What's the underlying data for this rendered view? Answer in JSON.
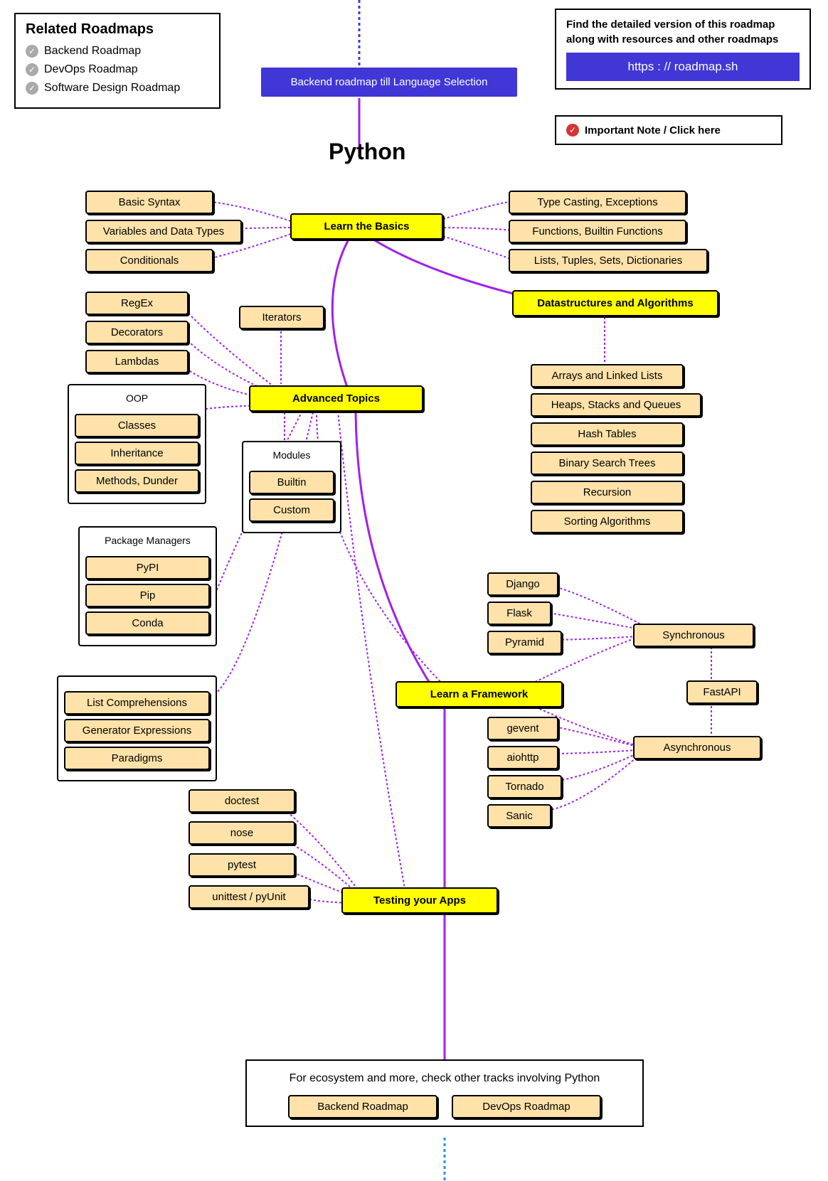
{
  "title": "Python",
  "related": {
    "heading": "Related Roadmaps",
    "items": [
      "Backend Roadmap",
      "DevOps Roadmap",
      "Software Design Roadmap"
    ]
  },
  "topBanner": {
    "text": "Find the detailed version of this roadmap along with resources and other roadmaps",
    "link": "https : // roadmap.sh"
  },
  "importantNote": "Important Note / Click here",
  "startNode": "Backend roadmap till Language Selection",
  "basics": {
    "main": "Learn the Basics",
    "left": [
      "Basic Syntax",
      "Variables and Data Types",
      "Conditionals"
    ],
    "right": [
      "Type Casting, Exceptions",
      "Functions, Builtin Functions",
      "Lists, Tuples, Sets, Dictionaries"
    ]
  },
  "dsa": {
    "main": "Datastructures and Algorithms",
    "items": [
      "Arrays and Linked Lists",
      "Heaps, Stacks and Queues",
      "Hash Tables",
      "Binary Search Trees",
      "Recursion",
      "Sorting Algorithms"
    ]
  },
  "advanced": {
    "main": "Advanced Topics",
    "iterators": "Iterators",
    "col1": [
      "RegEx",
      "Decorators",
      "Lambdas"
    ],
    "oop": {
      "title": "OOP",
      "items": [
        "Classes",
        "Inheritance",
        "Methods, Dunder"
      ]
    },
    "modules": {
      "title": "Modules",
      "items": [
        "Builtin",
        "Custom"
      ]
    },
    "pkg": {
      "title": "Package Managers",
      "items": [
        "PyPI",
        "Pip",
        "Conda"
      ]
    },
    "extras": [
      "List Comprehensions",
      "Generator Expressions",
      "Paradigms"
    ]
  },
  "framework": {
    "main": "Learn a Framework",
    "sync": {
      "label": "Synchronous",
      "items": [
        "Django",
        "Flask",
        "Pyramid"
      ]
    },
    "async": {
      "label": "Asynchronous",
      "extra": "FastAPI",
      "items": [
        "gevent",
        "aiohttp",
        "Tornado",
        "Sanic"
      ]
    }
  },
  "testing": {
    "main": "Testing your Apps",
    "items": [
      "doctest",
      "nose",
      "pytest",
      "unittest / pyUnit"
    ]
  },
  "footer": {
    "text": "For ecosystem and more, check other tracks involving Python",
    "links": [
      "Backend Roadmap",
      "DevOps Roadmap"
    ]
  }
}
